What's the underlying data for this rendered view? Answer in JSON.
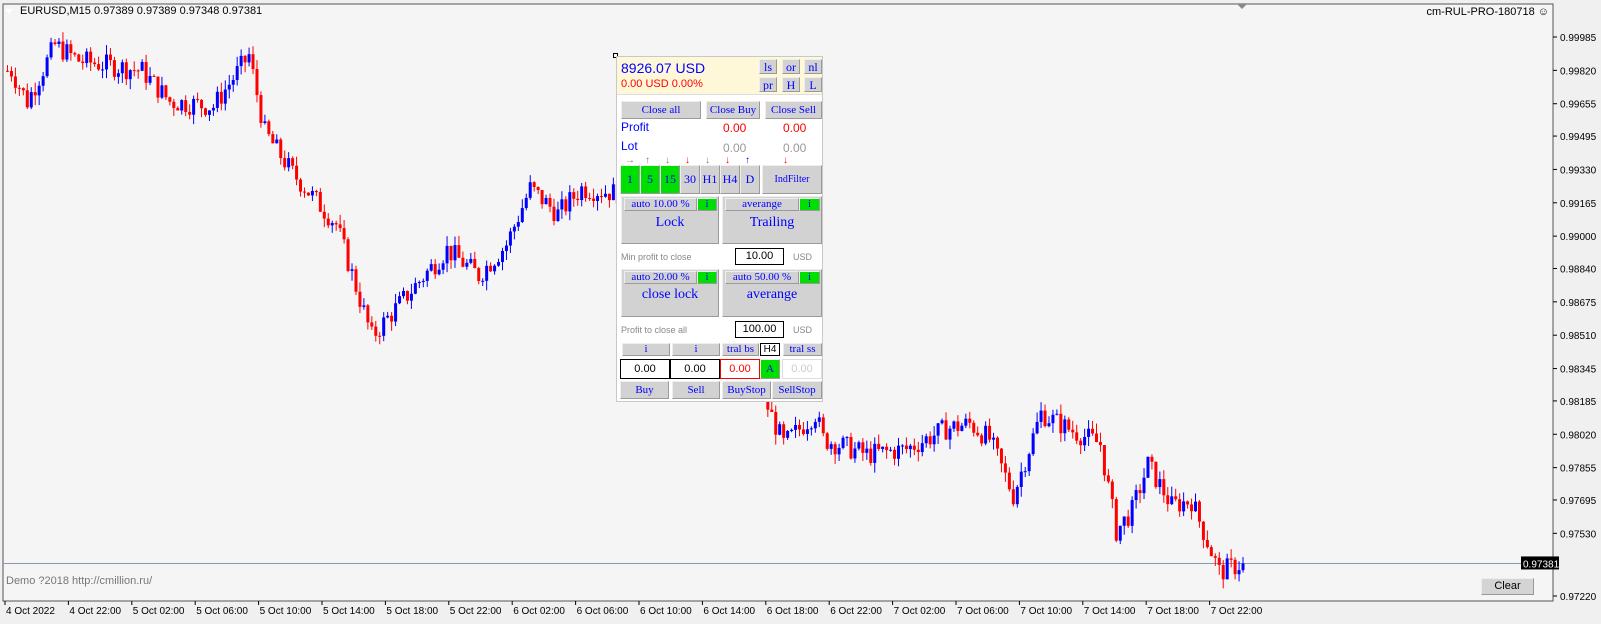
{
  "header": {
    "symbol_info": "EURUSD,M15  0.97389 0.97389 0.97348 0.97381",
    "ea_name": "cm-RUL-PRO-180718",
    "ea_icon": "smiley-icon",
    "watermark": "Demo ?2018 http://cmillion.ru/",
    "clear_label": "Clear"
  },
  "panel": {
    "balance": "8926.07 USD",
    "pnl": "0.00 USD  0.00%",
    "mini_buttons": [
      "ls",
      "or",
      "nl",
      "pr",
      "H",
      "L"
    ],
    "close_all": "Close all",
    "close_buy": "Close Buy",
    "close_sell": "Close Sell",
    "profit_label": "Profit",
    "profit_buy": "0.00",
    "profit_sell": "0.00",
    "lot_label": "Lot",
    "lot_buy": "0.00",
    "lot_sell": "0.00",
    "timeframes": [
      {
        "label": "1",
        "active": true,
        "arrow": "→",
        "arrow_color": "#808080"
      },
      {
        "label": "5",
        "active": true,
        "arrow": "↑",
        "arrow_color": "#808080"
      },
      {
        "label": "15",
        "active": true,
        "arrow": "↓",
        "arrow_color": "#808080"
      },
      {
        "label": "30",
        "active": false,
        "arrow": "↓",
        "arrow_color": "#ff0000"
      },
      {
        "label": "H1",
        "active": false,
        "arrow": "↓",
        "arrow_color": "#808080"
      },
      {
        "label": "H4",
        "active": false,
        "arrow": "↓",
        "arrow_color": "#ff0000"
      },
      {
        "label": "D",
        "active": false,
        "arrow": "↑",
        "arrow_color": "#0000ff"
      }
    ],
    "indfilter": {
      "label": "IndFilter",
      "arrow": "↓",
      "arrow_color": "#ff0000"
    },
    "lock": {
      "sub": "auto 10.00 %",
      "i": "i",
      "label": "Lock"
    },
    "trailing": {
      "sub": "averange",
      "i": "i",
      "label": "Trailing"
    },
    "min_profit_label": "Min profit to close",
    "min_profit_value": "10.00",
    "currency": "USD",
    "close_lock": {
      "sub": "auto 20.00 %",
      "i": "i",
      "label": "close lock"
    },
    "average": {
      "sub": "auto 50.00 %",
      "i": "i",
      "label": "averange"
    },
    "profit_all_label": "Profit to close all",
    "profit_all_value": "100.00",
    "row_i1": "i",
    "row_i2": "i",
    "tral_bs": "tral bs",
    "tf_sel": "H4",
    "tral_ss": "tral ss",
    "lot_buy_input": "0.00",
    "lot_sell_input": "0.00",
    "buystop_input": "0.00",
    "auto_a": "A",
    "sellstop_input": "0.00",
    "buy": "Buy",
    "sell": "Sell",
    "buystop": "BuyStop",
    "sellstop": "SellStop"
  },
  "chart_data": {
    "type": "candlestick",
    "symbol": "EURUSD",
    "timeframe": "M15",
    "current_price": "0.97381",
    "y_ticks": [
      "0.99985",
      "0.99820",
      "0.99655",
      "0.99495",
      "0.99330",
      "0.99165",
      "0.99000",
      "0.98840",
      "0.98675",
      "0.98510",
      "0.98345",
      "0.98185",
      "0.98020",
      "0.97855",
      "0.97695",
      "0.97530",
      "0.97220"
    ],
    "ylim": [
      0.9722,
      0.99985
    ],
    "x_ticks": [
      "4 Oct 2022",
      "4 Oct 22:00",
      "5 Oct 02:00",
      "5 Oct 06:00",
      "5 Oct 10:00",
      "5 Oct 14:00",
      "5 Oct 18:00",
      "5 Oct 22:00",
      "6 Oct 02:00",
      "6 Oct 06:00",
      "6 Oct 10:00",
      "6 Oct 14:00",
      "6 Oct 18:00",
      "6 Oct 22:00",
      "7 Oct 02:00",
      "7 Oct 06:00",
      "7 Oct 10:00",
      "7 Oct 14:00",
      "7 Oct 18:00",
      "7 Oct 22:00"
    ],
    "up_color": "#0000ff",
    "down_color": "#ff0000",
    "close_path": [
      [
        1,
        0.99818
      ],
      [
        5,
        0.99666
      ],
      [
        12,
        0.99945
      ],
      [
        18,
        0.99869
      ],
      [
        34,
        0.99818
      ],
      [
        41,
        0.99666
      ],
      [
        52,
        0.99641
      ],
      [
        61,
        0.99894
      ],
      [
        65,
        0.99514
      ],
      [
        72,
        0.99312
      ],
      [
        83,
        0.99059
      ],
      [
        92,
        0.98502
      ],
      [
        103,
        0.98755
      ],
      [
        111,
        0.98933
      ],
      [
        119,
        0.98806
      ],
      [
        126,
        0.98958
      ],
      [
        132,
        0.99236
      ],
      [
        139,
        0.9911
      ],
      [
        145,
        0.99236
      ],
      [
        155,
        0.99211
      ],
      [
        181,
        0.98654
      ],
      [
        196,
        0.97971
      ],
      [
        204,
        0.98123
      ],
      [
        206,
        0.97996
      ],
      [
        217,
        0.9792
      ],
      [
        227,
        0.97946
      ],
      [
        237,
        0.98047
      ],
      [
        243,
        0.98072
      ],
      [
        248,
        0.97996
      ],
      [
        254,
        0.97718
      ],
      [
        261,
        0.98123
      ],
      [
        268,
        0.98047
      ],
      [
        276,
        0.97971
      ],
      [
        280,
        0.97541
      ],
      [
        284,
        0.97642
      ],
      [
        288,
        0.9787
      ],
      [
        294,
        0.97667
      ],
      [
        299,
        0.97693
      ],
      [
        303,
        0.9749
      ],
      [
        306,
        0.97339
      ],
      [
        312,
        0.97381
      ]
    ]
  }
}
